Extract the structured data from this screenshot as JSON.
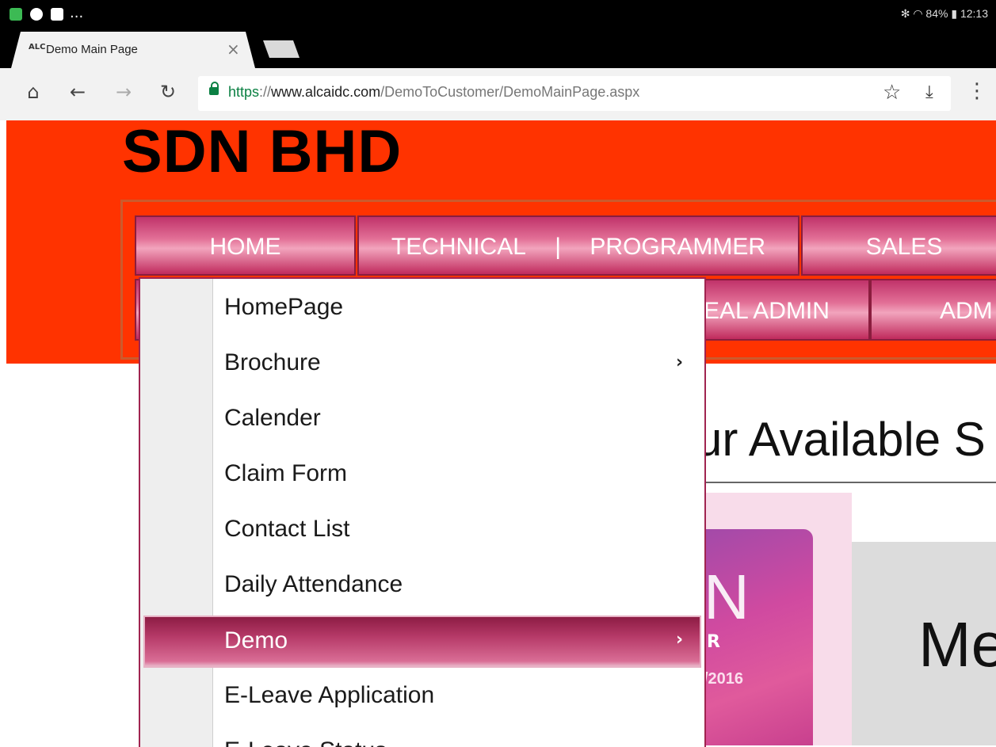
{
  "status_bar": {
    "battery": "84%",
    "time": "12:13",
    "notif_more": "..."
  },
  "browser": {
    "tab_title": "Demo Main Page",
    "tab_favicon": "ALC",
    "url_https": "https",
    "url_sep": "://",
    "url_host": "www.alcaidc.com",
    "url_path": "/DemoToCustomer/DemoMainPage.aspx",
    "icons": [
      "home-icon",
      "back-icon",
      "forward-icon",
      "reload-icon",
      "star-icon",
      "download-icon",
      "more-icon"
    ]
  },
  "page": {
    "company": "SDN BHD",
    "nav_row1": [
      "HOME",
      "TECHNICAL",
      "|",
      "PROGRAMMER",
      "SALES"
    ],
    "nav_row2": [
      "EAL ADMIN",
      "ADM"
    ],
    "heading": "ur Available S",
    "promo_big": "N",
    "promo_r": "R",
    "promo_year": "/2016",
    "right_text": "Me"
  },
  "dropdown": {
    "items": [
      {
        "label": "HomePage",
        "submenu": false
      },
      {
        "label": "Brochure",
        "submenu": true
      },
      {
        "label": "Calender",
        "submenu": false
      },
      {
        "label": "Claim Form",
        "submenu": false
      },
      {
        "label": "Contact List",
        "submenu": false
      },
      {
        "label": "Daily Attendance",
        "submenu": false
      },
      {
        "label": "Demo",
        "submenu": true,
        "selected": true
      },
      {
        "label": "E-Leave Application",
        "submenu": false
      },
      {
        "label": "E-Leave Status",
        "submenu": false
      }
    ],
    "arrow": "›"
  },
  "colors": {
    "banner": "#ff3300",
    "nav_accent": "#c0336a",
    "secure_green": "#0b8043"
  }
}
